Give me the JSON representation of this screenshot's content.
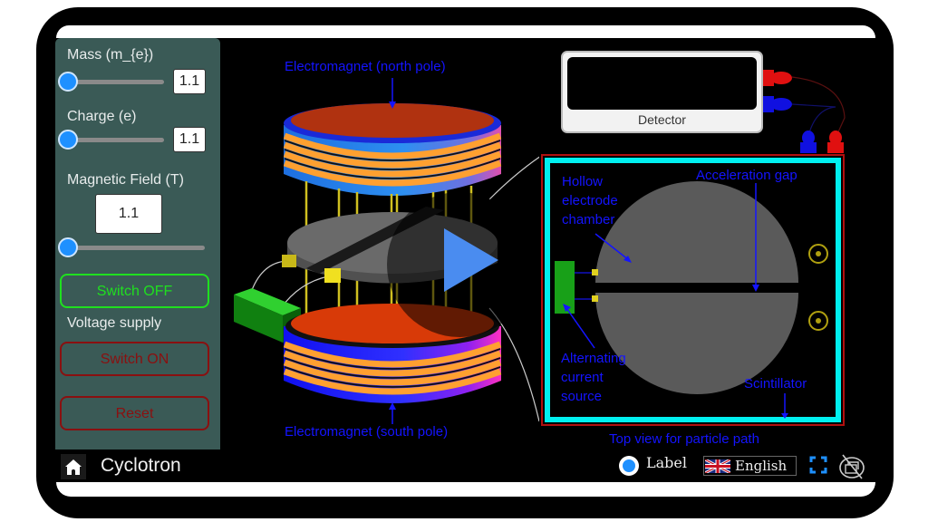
{
  "app": {
    "title": "Cyclotron"
  },
  "controls": {
    "mass": {
      "label": "Mass (m_{e})",
      "value": "1.1",
      "slider_fraction": 0.0
    },
    "charge": {
      "label": "Charge (e)",
      "value": "1.1",
      "slider_fraction": 0.0
    },
    "magnetic_field": {
      "label": "Magnetic Field (T)",
      "value": "1.1",
      "slider_fraction": 0.0
    },
    "switch_off_label": "Switch OFF",
    "voltage_supply_label": "Voltage supply",
    "switch_on_label": "Switch ON",
    "reset_label": "Reset"
  },
  "side_view": {
    "north_label": "Electromagnet (north pole)",
    "south_label": "Electromagnet (south pole)",
    "play_icon": "play-icon"
  },
  "top_view": {
    "detector_label": "Detector",
    "hollow_label": [
      "Hollow",
      "electrode",
      "chamber"
    ],
    "gap_label": "Acceleration gap",
    "ac_label": [
      "Alternating",
      "current",
      "source"
    ],
    "scintillator_label": "Scintillator",
    "caption": "Top view for particle path"
  },
  "footer": {
    "label_toggle": "Label",
    "language": "English",
    "home_icon": "home-icon",
    "fullscreen_icon": "fullscreen-icon",
    "screenshot_icon": "screenshot-disabled-icon"
  },
  "colors": {
    "panel": "#3a5a56",
    "accent_blue": "#1e90ff",
    "label_blue": "#1414ff",
    "switch_off_green": "#1fe01f",
    "switch_on_red": "#8a1010",
    "scintillator_cyan": "#00f0f0"
  }
}
